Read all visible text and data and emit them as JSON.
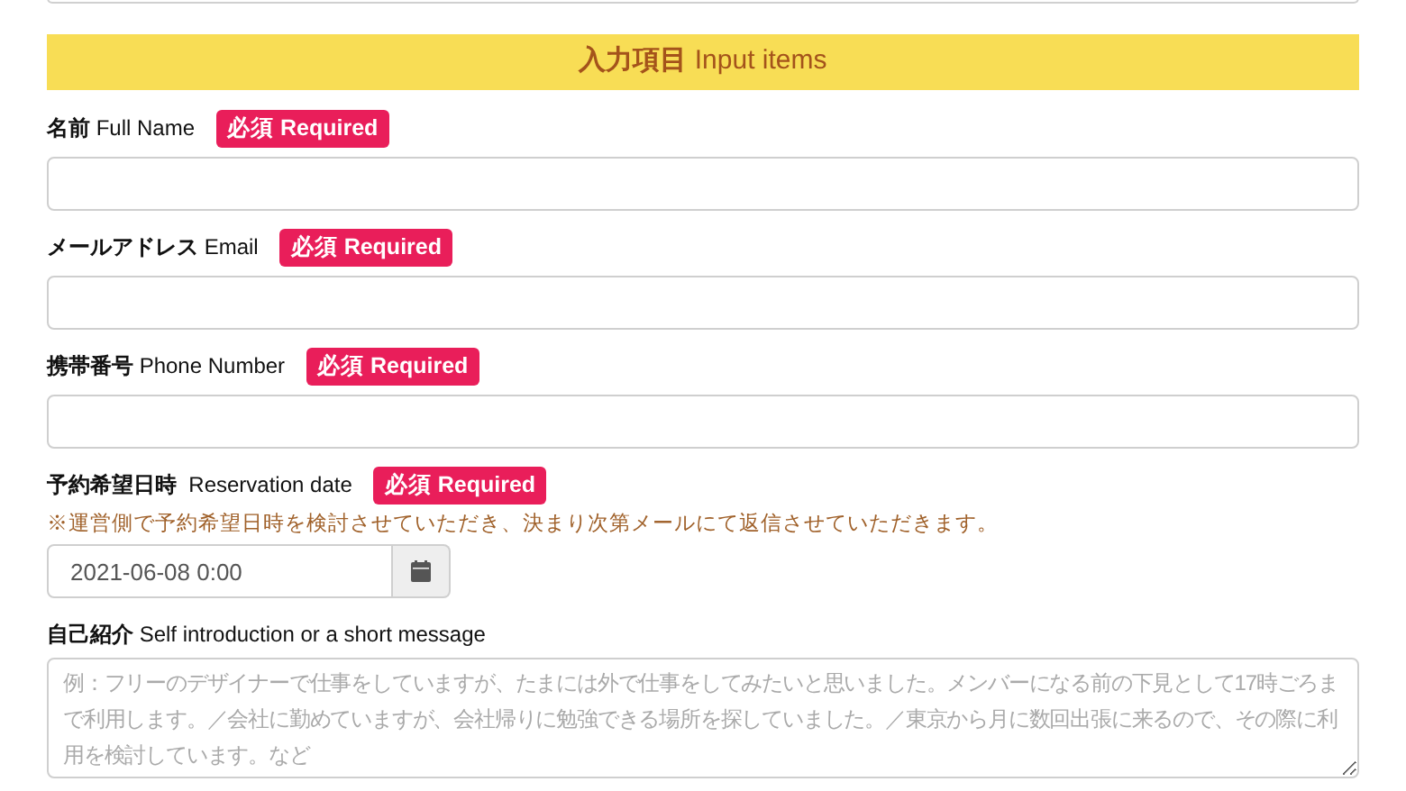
{
  "section_header": {
    "title_ja": "入力項目",
    "title_en": "Input items"
  },
  "fields": [
    {
      "kind": "text",
      "label_ja": "名前",
      "label_en": "Full Name",
      "badge": "必須 Required"
    },
    {
      "kind": "text",
      "label_ja": "メールアドレス",
      "label_en": "Email",
      "badge": "必須 Required"
    },
    {
      "kind": "text",
      "label_ja": "携帯番号",
      "label_en": "Phone Number",
      "badge": "必須 Required"
    },
    {
      "kind": "date",
      "label_ja": "予約希望日時",
      "label_en": "Reservation date",
      "badge": "必須 Required",
      "note": "※運営側で予約希望日時を検討させていただき、決まり次第メールにて返信させていただきます。",
      "value": "2021-06-08 0:00"
    },
    {
      "kind": "textarea",
      "label_ja": "自己紹介",
      "label_en": "Self introduction or a short message",
      "placeholder": "例：フリーのデザイナーで仕事をしていますが、たまには外で仕事をしてみたいと思いました。メンバーになる前の下見として17時ごろまで利用します。／会社に勤めていますが、会社帰りに勉強できる場所を探していました。／東京から月に数回出張に来るので、その際に利用を検討しています。など"
    }
  ]
}
